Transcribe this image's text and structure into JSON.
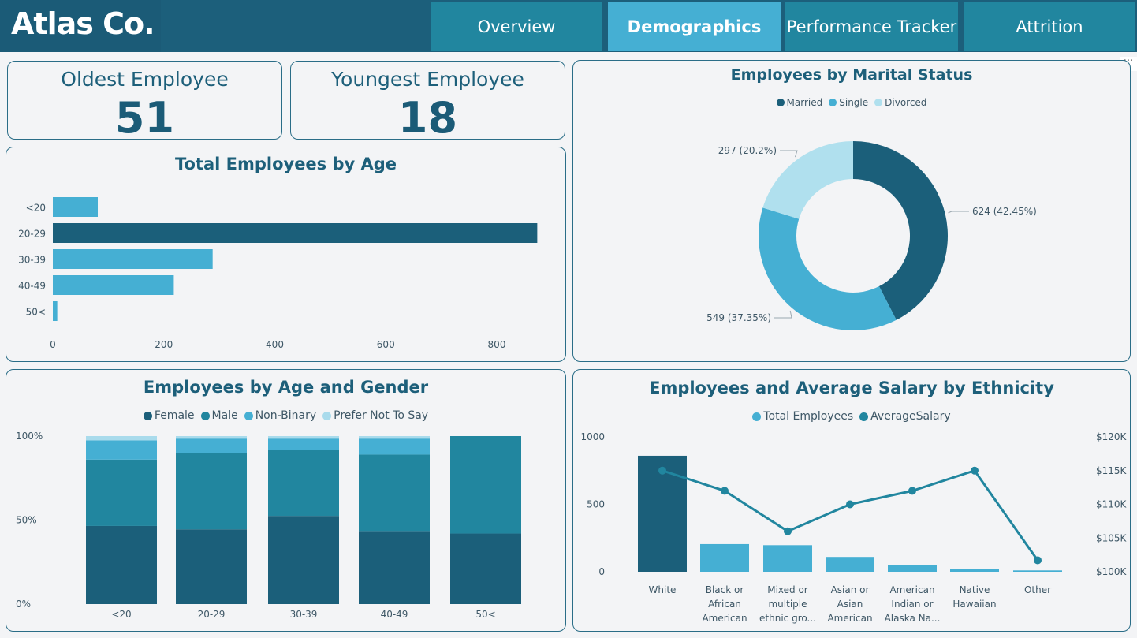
{
  "header": {
    "brand": "Atlas Co.",
    "tabs": [
      {
        "label": "Overview",
        "active": false
      },
      {
        "label": "Demographics",
        "active": true
      },
      {
        "label": "Performance Tracker",
        "active": false
      },
      {
        "label": "Attrition",
        "active": false
      }
    ]
  },
  "more_options": "···",
  "kpis": {
    "oldest": {
      "label": "Oldest Employee",
      "value": "51"
    },
    "youngest": {
      "label": "Youngest Employee",
      "value": "18"
    }
  },
  "colors": {
    "dark": "#1b5f7a",
    "teal": "#21869f",
    "light": "#45afd3",
    "pale": "#a9dbec"
  },
  "chart_data": [
    {
      "id": "age",
      "type": "bar",
      "orientation": "horizontal",
      "title": "Total Employees by Age",
      "categories": [
        "<20",
        "20-29",
        "30-39",
        "40-49",
        "50<"
      ],
      "values": [
        81,
        873,
        288,
        218,
        8
      ],
      "highlight_index": 1,
      "xlim": [
        0,
        900
      ],
      "xticks": [
        0,
        200,
        400,
        600,
        800
      ],
      "grid": false
    },
    {
      "id": "marital",
      "type": "pie",
      "variant": "donut",
      "title": "Employees by Marital Status",
      "categories": [
        "Married",
        "Single",
        "Divorced"
      ],
      "values": [
        624,
        549,
        297
      ],
      "labels": [
        "624 (42.45%)",
        "549 (37.35%)",
        "297 (20.2%)"
      ],
      "colors": [
        "#1b5f7a",
        "#45afd3",
        "#b0e0ee"
      ],
      "legend": "top"
    },
    {
      "id": "age_gender",
      "type": "bar",
      "variant": "100% stacked",
      "title": "Employees by Age and Gender",
      "categories": [
        "<20",
        "20-29",
        "30-39",
        "40-49",
        "50<"
      ],
      "series": [
        {
          "name": "Female",
          "values": [
            46.5,
            44.5,
            52.5,
            43.5,
            42
          ],
          "color": "#1b5f7a"
        },
        {
          "name": "Male",
          "values": [
            39.5,
            45.5,
            39.5,
            45.5,
            58
          ],
          "color": "#21869f"
        },
        {
          "name": "Non-Binary",
          "values": [
            11.5,
            8.5,
            6.5,
            9.5,
            0
          ],
          "color": "#45afd3"
        },
        {
          "name": "Prefer Not To Say",
          "values": [
            2.5,
            1.5,
            1.5,
            1.5,
            0
          ],
          "color": "#a9dbec"
        }
      ],
      "yticks": [
        "0%",
        "50%",
        "100%"
      ],
      "legend": "top"
    },
    {
      "id": "ethnicity",
      "type": "bar",
      "variant": "bar + line combo",
      "title": "Employees and Average Salary by Ethnicity",
      "categories": [
        [
          "White"
        ],
        [
          "Black or",
          "African",
          "American"
        ],
        [
          "Mixed or",
          "multiple",
          "ethnic gro..."
        ],
        [
          "Asian or",
          "Asian",
          "American"
        ],
        [
          "American",
          "Indian or",
          "Alaska Na..."
        ],
        [
          "Native",
          "Hawaiian"
        ],
        [
          "Other"
        ]
      ],
      "series": [
        {
          "name": "Total Employees",
          "type": "bar",
          "axis": "left",
          "values": [
            860,
            205,
            197,
            110,
            48,
            22,
            10
          ],
          "color": "#45afd3",
          "highlight_index": 0,
          "highlight_color": "#1b5f7a"
        },
        {
          "name": "AverageSalary",
          "type": "line",
          "axis": "right",
          "values": [
            115000,
            112000,
            106000,
            110000,
            112000,
            115000,
            101700
          ],
          "color": "#21869f"
        }
      ],
      "y_left": {
        "range": [
          0,
          1000
        ],
        "ticks": [
          "0",
          "500",
          "1000"
        ]
      },
      "y_right": {
        "range": [
          100000,
          120000
        ],
        "ticks": [
          "$100K",
          "$105K",
          "$110K",
          "$115K",
          "$120K"
        ]
      },
      "legend": "top"
    }
  ]
}
